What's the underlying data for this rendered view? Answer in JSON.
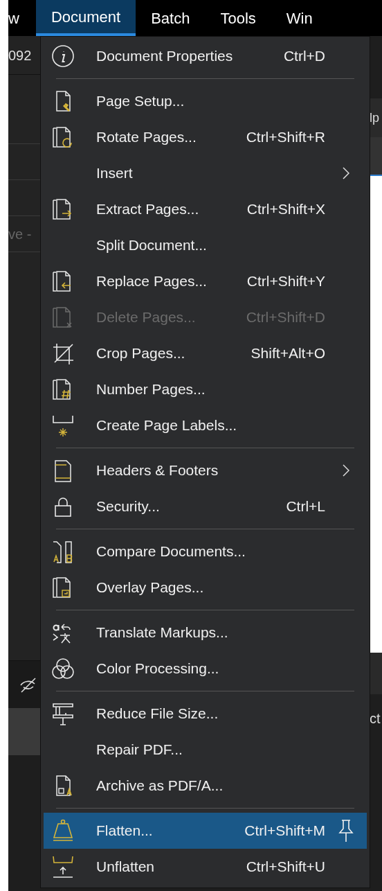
{
  "menu_bar": [
    {
      "label": "w",
      "selected": false
    },
    {
      "label": "Document",
      "selected": true
    },
    {
      "label": "Batch",
      "selected": false
    },
    {
      "label": "Tools",
      "selected": false
    },
    {
      "label": "Win",
      "selected": false
    }
  ],
  "background": {
    "left_texts": [
      "092",
      "ve -"
    ],
    "right_texts": [
      "lp",
      "ct"
    ]
  },
  "menu": [
    {
      "kind": "item",
      "label": "Document Properties",
      "shortcut": "Ctrl+D",
      "disabled": false,
      "submenu": false,
      "selected": false
    },
    {
      "kind": "separator"
    },
    {
      "kind": "item",
      "label": "Page Setup...",
      "disabled": false,
      "submenu": false,
      "selected": false
    },
    {
      "kind": "item",
      "label": "Rotate Pages...",
      "shortcut": "Ctrl+Shift+R",
      "disabled": false,
      "submenu": false,
      "selected": false
    },
    {
      "kind": "item",
      "label": "Insert",
      "disabled": false,
      "submenu": true,
      "selected": false
    },
    {
      "kind": "item",
      "label": "Extract Pages...",
      "shortcut": "Ctrl+Shift+X",
      "disabled": false,
      "submenu": false,
      "selected": false
    },
    {
      "kind": "item",
      "label": "Split Document...",
      "disabled": false,
      "submenu": false,
      "selected": false
    },
    {
      "kind": "item",
      "label": "Replace Pages...",
      "shortcut": "Ctrl+Shift+Y",
      "disabled": false,
      "submenu": false,
      "selected": false
    },
    {
      "kind": "item",
      "label": "Delete Pages...",
      "shortcut": "Ctrl+Shift+D",
      "disabled": true,
      "submenu": false,
      "selected": false
    },
    {
      "kind": "item",
      "label": "Crop Pages...",
      "shortcut": "Shift+Alt+O",
      "disabled": false,
      "submenu": false,
      "selected": false
    },
    {
      "kind": "item",
      "label": "Number Pages...",
      "disabled": false,
      "submenu": false,
      "selected": false
    },
    {
      "kind": "item",
      "label": "Create Page Labels...",
      "disabled": false,
      "submenu": false,
      "selected": false
    },
    {
      "kind": "separator"
    },
    {
      "kind": "item",
      "label": "Headers & Footers",
      "disabled": false,
      "submenu": true,
      "selected": false
    },
    {
      "kind": "item",
      "label": "Security...",
      "shortcut": "Ctrl+L",
      "disabled": false,
      "submenu": false,
      "selected": false
    },
    {
      "kind": "separator"
    },
    {
      "kind": "item",
      "label": "Compare Documents...",
      "disabled": false,
      "submenu": false,
      "selected": false
    },
    {
      "kind": "item",
      "label": "Overlay Pages...",
      "disabled": false,
      "submenu": false,
      "selected": false
    },
    {
      "kind": "separator"
    },
    {
      "kind": "item",
      "label": "Translate Markups...",
      "disabled": false,
      "submenu": false,
      "selected": false
    },
    {
      "kind": "item",
      "label": "Color Processing...",
      "disabled": false,
      "submenu": false,
      "selected": false
    },
    {
      "kind": "separator"
    },
    {
      "kind": "item",
      "label": "Reduce File Size...",
      "disabled": false,
      "submenu": false,
      "selected": false
    },
    {
      "kind": "item",
      "label": "Repair PDF...",
      "disabled": false,
      "submenu": false,
      "selected": false
    },
    {
      "kind": "item",
      "label": "Archive as PDF/A...",
      "disabled": false,
      "submenu": false,
      "selected": false
    },
    {
      "kind": "separator"
    },
    {
      "kind": "item",
      "label": "Flatten...",
      "shortcut": "Ctrl+Shift+M",
      "disabled": false,
      "submenu": false,
      "selected": true
    },
    {
      "kind": "item",
      "label": "Unflatten",
      "shortcut": "Ctrl+Shift+U",
      "disabled": false,
      "submenu": false,
      "selected": false
    }
  ]
}
